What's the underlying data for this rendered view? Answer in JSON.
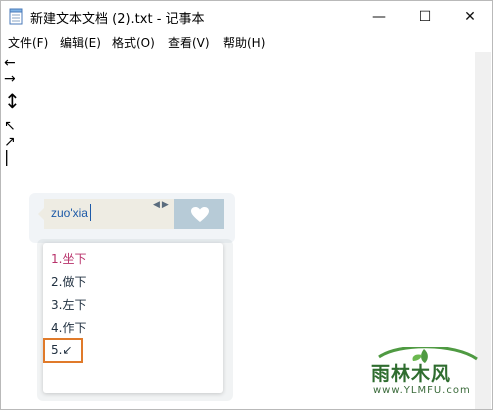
{
  "window": {
    "title": "新建文本文档 (2).txt - 记事本",
    "minimize_glyph": "—",
    "maximize_glyph": "☐",
    "close_glyph": "✕"
  },
  "menu": {
    "items": [
      "文件(F)",
      "编辑(E)",
      "格式(O)",
      "查看(V)",
      "帮助(H)"
    ]
  },
  "document": {
    "lines": [
      "←",
      "→",
      "↕",
      "↖",
      "↗",
      "|"
    ]
  },
  "ime": {
    "composition": "zuo'xia",
    "page_arrows": "◀▶",
    "accent_color": "#1d5aa8",
    "candidates": [
      "1.坐下",
      "2.做下",
      "3.左下",
      "4.作下",
      "5.↙"
    ],
    "highlight_color": "#e07a2a"
  },
  "watermark": {
    "name": "雨林木风",
    "url": "www.YLMFU.com"
  }
}
